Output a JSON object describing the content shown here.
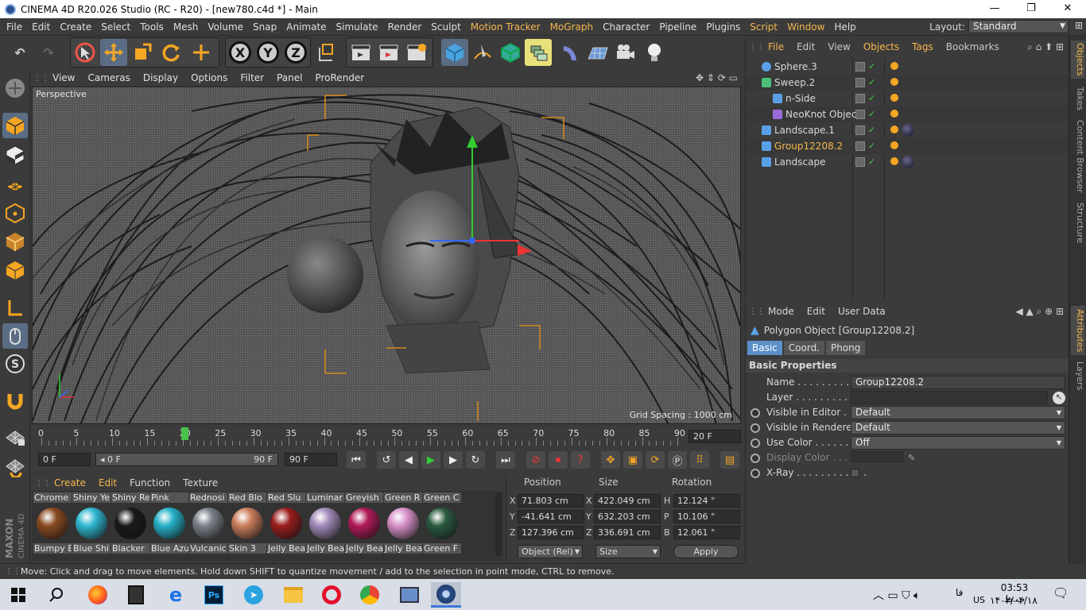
{
  "window": {
    "title": "CINEMA 4D R20.026 Studio (RC - R20) - [new780.c4d *] - Main",
    "minimize": "—",
    "maximize": "❐",
    "close": "✕"
  },
  "menu": {
    "items": [
      "File",
      "Edit",
      "Create",
      "Select",
      "Tools",
      "Mesh",
      "Volume",
      "Snap",
      "Animate",
      "Simulate",
      "Render",
      "Sculpt",
      "Motion Tracker",
      "MoGraph",
      "Character",
      "Pipeline",
      "Plugins",
      "Script",
      "Window",
      "Help"
    ],
    "highlighted": [
      "Motion Tracker",
      "MoGraph",
      "Script",
      "Window"
    ],
    "layout_label": "Layout:",
    "layout_value": "Standard"
  },
  "toolbar": {
    "x_label": "X",
    "y_label": "Y",
    "z_label": "Z"
  },
  "viewport": {
    "menu": [
      "View",
      "Cameras",
      "Display",
      "Options",
      "Filter",
      "Panel",
      "ProRender"
    ],
    "camera_label": "Perspective",
    "grid_spacing": "Grid Spacing : 1000 cm"
  },
  "timeline": {
    "ticks": [
      "0",
      "5",
      "10",
      "15",
      "20",
      "25",
      "30",
      "35",
      "40",
      "45",
      "50",
      "55",
      "60",
      "65",
      "70",
      "75",
      "80",
      "85",
      "90"
    ],
    "current_frame": "20",
    "end_field": "20 F",
    "start_field": "0 F",
    "range_start": "◂ 0 F",
    "range_end": "90 F",
    "max_field": "90 F"
  },
  "materials": {
    "menu": [
      "Create",
      "Edit",
      "Function",
      "Texture"
    ],
    "top_labels": [
      "Chrome",
      "Shiny Ye",
      "Shiny Re",
      "Pink",
      "Rednosi",
      "Red Blo",
      "Red Slu",
      "Luminar",
      "Greyish",
      "Green R",
      "Green C"
    ],
    "items": [
      {
        "label": "Bumpy E",
        "color": "#8a4a22"
      },
      {
        "label": "Blue Shi",
        "color": "#2fb8d0"
      },
      {
        "label": "Blacker",
        "color": "#1a1a1a"
      },
      {
        "label": "Blue Azu",
        "color": "#26b0c8"
      },
      {
        "label": "Vulcanic",
        "color": "#7a8088"
      },
      {
        "label": "Skin 3",
        "color": "#c97c5a"
      },
      {
        "label": "Jelly Bea",
        "color": "#9a1e1e"
      },
      {
        "label": "Jelly Bea",
        "color": "#a08ab8"
      },
      {
        "label": "Jelly Bea",
        "color": "#b01a58"
      },
      {
        "label": "Jelly Bea",
        "color": "#d890c8"
      },
      {
        "label": "Green F",
        "color": "#2a5a40"
      }
    ]
  },
  "coordinates": {
    "headers": [
      "Position",
      "Size",
      "Rotation"
    ],
    "rows": [
      {
        "axis": "X",
        "pos": "71.803 cm",
        "saxis": "X",
        "size": "422.049 cm",
        "raxis": "H",
        "rot": "12.124 °"
      },
      {
        "axis": "Y",
        "pos": "-41.641 cm",
        "saxis": "Y",
        "size": "632.203 cm",
        "raxis": "P",
        "rot": "10.106 °"
      },
      {
        "axis": "Z",
        "pos": "127.396 cm",
        "saxis": "Z",
        "size": "336.691 cm",
        "raxis": "B",
        "rot": "12.061 °"
      }
    ],
    "mode": "Object (Rel)",
    "size_mode": "Size",
    "apply": "Apply"
  },
  "status": "Move: Click and drag to move elements. Hold down SHIFT to quantize movement / add to the selection in point mode, CTRL to remove.",
  "objects": {
    "menu": [
      "File",
      "Edit",
      "View",
      "Objects",
      "Tags",
      "Bookmarks"
    ],
    "highlighted": [
      "File",
      "Objects",
      "Tags"
    ],
    "rows": [
      {
        "name": "Sphere.3",
        "indent": 0,
        "selected": false
      },
      {
        "name": "Sweep.2",
        "indent": 0,
        "selected": false
      },
      {
        "name": "n-Side",
        "indent": 1,
        "selected": false
      },
      {
        "name": "NeoKnot Object",
        "indent": 1,
        "selected": false
      },
      {
        "name": "Landscape.1",
        "indent": 0,
        "selected": false
      },
      {
        "name": "Group12208.2",
        "indent": 0,
        "selected": true
      },
      {
        "name": "Landscape",
        "indent": 0,
        "selected": false
      }
    ]
  },
  "attributes": {
    "menu": [
      "Mode",
      "Edit",
      "User Data"
    ],
    "object_title": "Polygon Object [Group12208.2]",
    "tabs": [
      "Basic",
      "Coord.",
      "Phong"
    ],
    "section": "Basic Properties",
    "fields": [
      {
        "label": "Name . . . . . . . . . . . . .",
        "value": "Group12208.2"
      },
      {
        "label": "Layer . . . . . . . . . . . .",
        "value": ""
      },
      {
        "label": "Visible in Editor . . . .",
        "value": "Default"
      },
      {
        "label": "Visible in Renderer",
        "value": "Default"
      },
      {
        "label": "Use Color . . . . . . . . .",
        "value": "Off"
      },
      {
        "label": "Display Color . . .",
        "value": ""
      },
      {
        "label": "X-Ray . . . . . . . . . . . .",
        "value": ""
      }
    ]
  },
  "right_tabs": [
    "Objects",
    "Takes",
    "Content Browser",
    "Structure",
    "Attributes",
    "Layers"
  ],
  "taskbar": {
    "time": "03:53 ب.ظ",
    "date": "۱۴۰۲/۰۴/۱۸",
    "lang": "فا",
    "region": "US"
  },
  "colors": {
    "accent": "#f5b74e",
    "selection": "#5a6d84"
  }
}
